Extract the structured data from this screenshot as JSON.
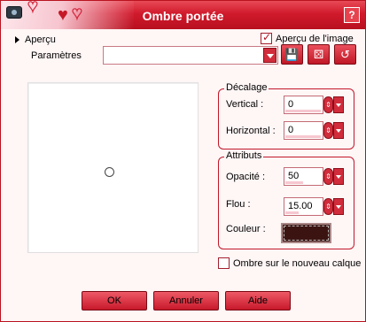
{
  "window": {
    "title": "Ombre portée",
    "help_label": "?"
  },
  "top": {
    "apercu_label": "Aperçu",
    "preview_image_label": "Aperçu de l'image",
    "preview_image_checked": true,
    "params_label": "Paramètres",
    "preset_value": ""
  },
  "offset": {
    "title": "Décalage",
    "vertical_label": "Vertical :",
    "vertical_value": "0",
    "horizontal_label": "Horizontal :",
    "horizontal_value": "0"
  },
  "attributes": {
    "title": "Attributs",
    "opacity_label": "Opacité :",
    "opacity_value": "50",
    "blur_label": "Flou :",
    "blur_value": "15.00",
    "color_label": "Couleur :",
    "color_value": "#3b1412"
  },
  "new_layer": {
    "label": "Ombre sur le nouveau calque",
    "checked": false
  },
  "buttons": {
    "ok": "OK",
    "cancel": "Annuler",
    "help": "Aide"
  },
  "colors": {
    "accent": "#d12c3b",
    "titlebar": "#d01a2c",
    "background": "#fff6f6"
  }
}
